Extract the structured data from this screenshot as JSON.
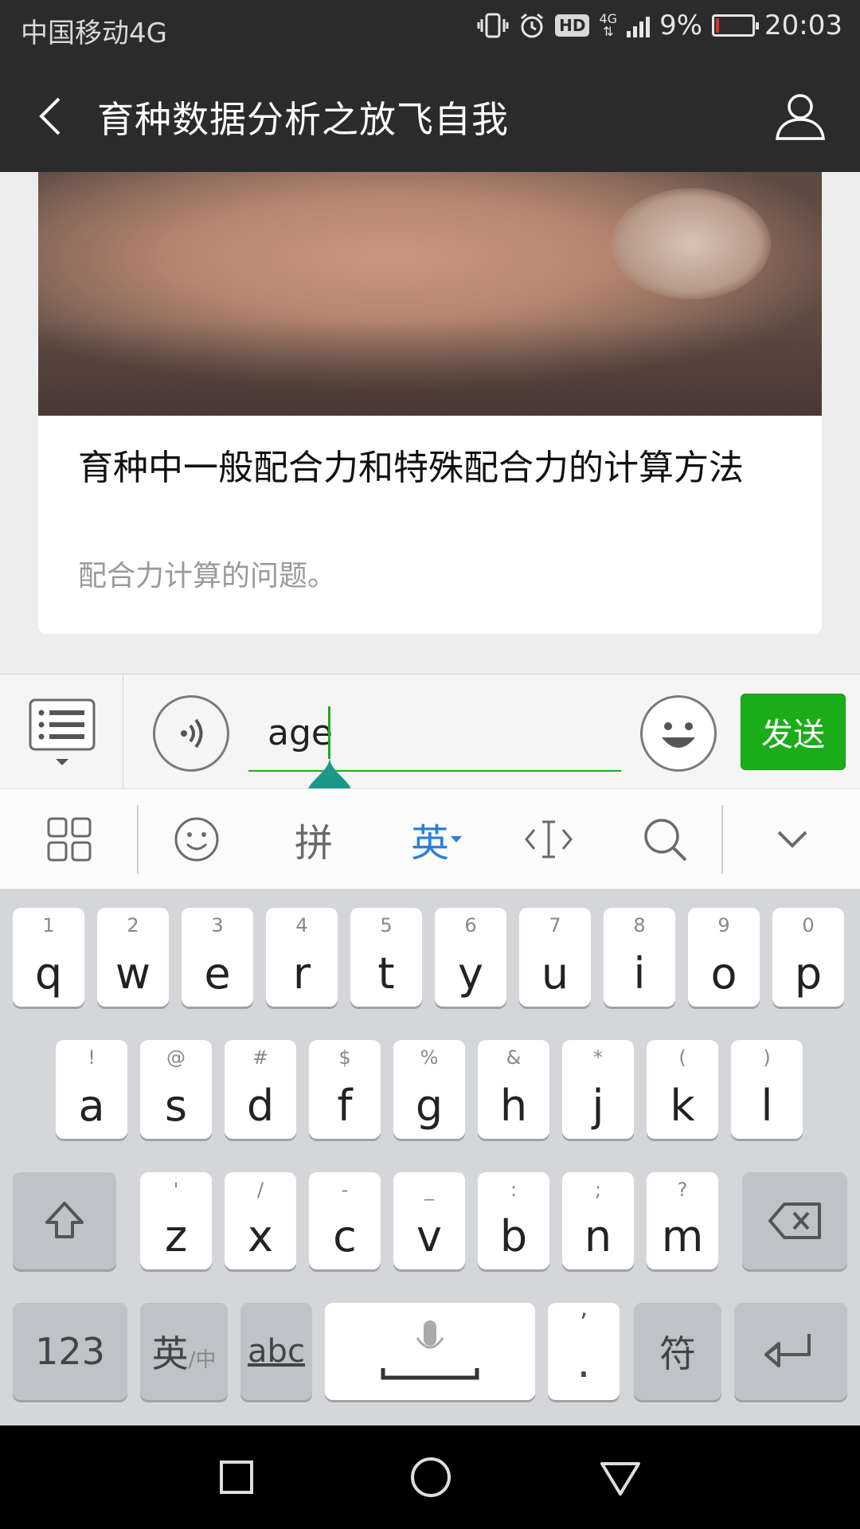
{
  "status_bar": {
    "carrier": "中国移动4G",
    "net_type": "4G",
    "battery_percent": "9%",
    "battery_level": 0.09,
    "time": "20:03",
    "hd_label": "HD",
    "icons": [
      "vibrate-icon",
      "alarm-icon",
      "hd-icon",
      "signal-icon",
      "battery-icon"
    ]
  },
  "header": {
    "title": "育种数据分析之放飞自我",
    "back_icon": "back-arrow-icon",
    "profile_icon": "person-icon"
  },
  "article_card": {
    "title": "育种中一般配合力和特殊配合力的计算方法",
    "description": "配合力计算的问题。"
  },
  "input_bar": {
    "text_value": "age",
    "send_label": "发送",
    "accent_color": "#1aad19"
  },
  "ime_toolbar": {
    "pinyin_label": "拼",
    "english_label": "英",
    "active_color": "#2a80d8"
  },
  "keyboard": {
    "row1": [
      {
        "main": "q",
        "sub": "1"
      },
      {
        "main": "w",
        "sub": "2"
      },
      {
        "main": "e",
        "sub": "3"
      },
      {
        "main": "r",
        "sub": "4"
      },
      {
        "main": "t",
        "sub": "5"
      },
      {
        "main": "y",
        "sub": "6"
      },
      {
        "main": "u",
        "sub": "7"
      },
      {
        "main": "i",
        "sub": "8"
      },
      {
        "main": "o",
        "sub": "9"
      },
      {
        "main": "p",
        "sub": "0"
      }
    ],
    "row2": [
      {
        "main": "a",
        "sub": "!"
      },
      {
        "main": "s",
        "sub": "@"
      },
      {
        "main": "d",
        "sub": "#"
      },
      {
        "main": "f",
        "sub": "$"
      },
      {
        "main": "g",
        "sub": "%"
      },
      {
        "main": "h",
        "sub": "&"
      },
      {
        "main": "j",
        "sub": "*"
      },
      {
        "main": "k",
        "sub": "("
      },
      {
        "main": "l",
        "sub": ")"
      }
    ],
    "row3": [
      {
        "main": "z",
        "sub": "'"
      },
      {
        "main": "x",
        "sub": "/"
      },
      {
        "main": "c",
        "sub": "-"
      },
      {
        "main": "v",
        "sub": "_"
      },
      {
        "main": "b",
        "sub": ":"
      },
      {
        "main": "n",
        "sub": ";"
      },
      {
        "main": "m",
        "sub": "?"
      }
    ],
    "numbers_label": "123",
    "lang_switch_main": "英",
    "lang_switch_sub": "/中",
    "abc_label": "abc",
    "period_label": ".",
    "comma_label": "’",
    "symbols_label": "符"
  }
}
